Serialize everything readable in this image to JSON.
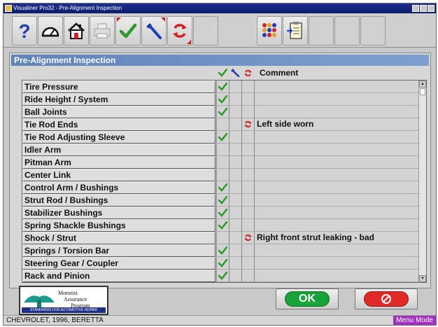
{
  "window": {
    "title": "Visualiner Pro32 - Pre-Alignment Inspection"
  },
  "toolbar": {
    "buttons": [
      {
        "name": "help",
        "icon": "question-mark-icon"
      },
      {
        "name": "gauge",
        "icon": "gauge-icon"
      },
      {
        "name": "home",
        "icon": "home-icon"
      },
      {
        "name": "print",
        "icon": "printer-icon"
      },
      {
        "name": "inspection-ok",
        "icon": "green-check-icon"
      },
      {
        "name": "repair",
        "icon": "blue-wrench-icon"
      },
      {
        "name": "replace",
        "icon": "red-arrows-icon"
      },
      {
        "name": "pattern",
        "icon": "dots-pattern-icon"
      },
      {
        "name": "clipboard",
        "icon": "clipboard-arrow-icon"
      }
    ]
  },
  "panel": {
    "title": "Pre-Alignment Inspection",
    "comment_header": "Comment",
    "column_icons": [
      "green-check-icon",
      "blue-wrench-icon",
      "red-arrows-icon"
    ]
  },
  "rows": [
    {
      "name": "Tire Pressure",
      "ok": true,
      "repair": false,
      "replace": false,
      "comment": ""
    },
    {
      "name": "Ride Height / System",
      "ok": true,
      "repair": false,
      "replace": false,
      "comment": ""
    },
    {
      "name": "Ball Joints",
      "ok": true,
      "repair": false,
      "replace": false,
      "comment": ""
    },
    {
      "name": "Tie Rod Ends",
      "ok": false,
      "repair": false,
      "replace": true,
      "comment": "Left side worn"
    },
    {
      "name": "Tie Rod Adjusting Sleeve",
      "ok": true,
      "repair": false,
      "replace": false,
      "comment": ""
    },
    {
      "name": "Idler Arm",
      "ok": false,
      "repair": false,
      "replace": false,
      "comment": ""
    },
    {
      "name": "Pitman Arm",
      "ok": false,
      "repair": false,
      "replace": false,
      "comment": ""
    },
    {
      "name": "Center Link",
      "ok": false,
      "repair": false,
      "replace": false,
      "comment": ""
    },
    {
      "name": "Control Arm / Bushings",
      "ok": true,
      "repair": false,
      "replace": false,
      "comment": ""
    },
    {
      "name": "Strut Rod / Bushings",
      "ok": true,
      "repair": false,
      "replace": false,
      "comment": ""
    },
    {
      "name": "Stabilizer Bushings",
      "ok": true,
      "repair": false,
      "replace": false,
      "comment": ""
    },
    {
      "name": "Spring Shackle Bushings",
      "ok": true,
      "repair": false,
      "replace": false,
      "comment": ""
    },
    {
      "name": "Shock / Strut",
      "ok": false,
      "repair": false,
      "replace": true,
      "comment": "Right front strut leaking - bad"
    },
    {
      "name": "Springs / Torsion Bar",
      "ok": true,
      "repair": false,
      "replace": false,
      "comment": ""
    },
    {
      "name": "Steering Gear / Coupler",
      "ok": true,
      "repair": false,
      "replace": false,
      "comment": ""
    },
    {
      "name": "Rack and Pinion",
      "ok": true,
      "repair": false,
      "replace": false,
      "comment": ""
    }
  ],
  "logo": {
    "line1": "Motorist",
    "line2": "Assurance",
    "line3": "Program",
    "tagline": "STANDARDS FOR AUTOMOTIVE REPAIR"
  },
  "buttons": {
    "ok_label": "OK",
    "cancel_icon": "no-entry-icon"
  },
  "status": {
    "vehicle": "CHEVROLET, 1996, BERETTA",
    "mode": "Menu Mode"
  },
  "colors": {
    "check": "#2a9a2a",
    "wrench": "#1f3fb4",
    "replace": "#d42020",
    "panel_title": "#6a8fc4",
    "mode_badge": "#a030c0"
  }
}
